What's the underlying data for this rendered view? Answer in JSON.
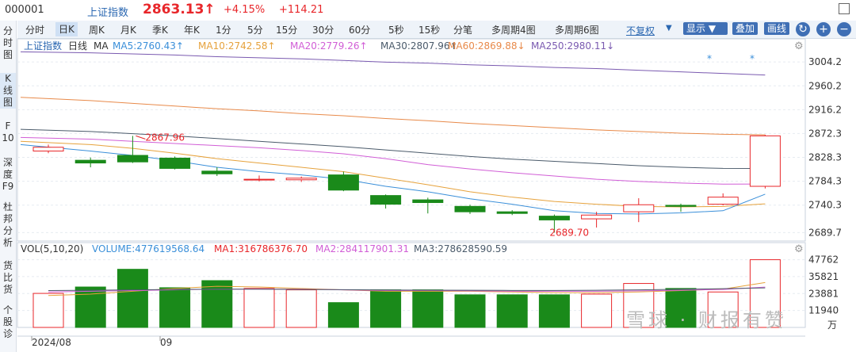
{
  "header": {
    "code": "000001",
    "name": "上证指数",
    "price": "2863.13↑",
    "change_pct": "+4.15%",
    "change_val": "+114.21"
  },
  "toolbar": {
    "tabs": [
      "分时",
      "日K",
      "周K",
      "月K",
      "季K",
      "年K",
      "1分",
      "5分",
      "15分",
      "30分",
      "60分",
      "5秒",
      "15秒",
      "分笔",
      "多周期4图",
      "多周期6图"
    ],
    "active": "日K",
    "fuquan": "不复权",
    "display": "显示",
    "overlay": "叠加",
    "draw": "画线"
  },
  "sidebar": [
    {
      "label": "分\n时\n图"
    },
    {
      "label": "K\n线\n图",
      "active": true
    },
    {
      "label": "F\n10"
    },
    {
      "label": "深\n度\nF9"
    },
    {
      "label": "杜\n邦\n分\n析"
    },
    {
      "label": "货\n比\n货"
    },
    {
      "label": "个\n股\n诊"
    }
  ],
  "ma_legend": {
    "name": "上证指数",
    "period": "日线",
    "label": "MA",
    "ma5": "MA5:2760.43↑",
    "ma10": "MA10:2742.58↑",
    "ma20": "MA20:2779.26↑",
    "ma30": "MA30:2807.96↑",
    "ma60": "MA60:2869.88↓",
    "ma250": "MA250:2980.11↓"
  },
  "vol_legend": {
    "label": "VOL(5,10,20)",
    "volume": "VOLUME:477619568.64",
    "ma1": "MA1:316786376.70",
    "ma2": "MA2:284117901.31",
    "ma3": "MA3:278628590.59"
  },
  "annotations": {
    "high": "2867.96",
    "low": "2689.70"
  },
  "watermark": "雪球 · 财报有赞",
  "colors": {
    "up": "#e8262a",
    "down": "#1a8a1a",
    "ma5": "#3a8fd9",
    "ma10": "#e6a23c",
    "ma20": "#d15ed6",
    "ma30": "#4a5a6a",
    "ma60": "#e88a4a",
    "ma250": "#7a5ab0"
  },
  "chart_data": {
    "type": "candlestick",
    "price_ticks": [
      3004.2,
      2960.2,
      2916.2,
      2872.3,
      2828.3,
      2784.3,
      2740.3,
      2689.7
    ],
    "volume_ticks": [
      47762,
      35821,
      23881,
      11940
    ],
    "volume_unit": "万",
    "x_labels": [
      "2024/08",
      "09"
    ],
    "candles": [
      {
        "o": 2840,
        "c": 2847,
        "h": 2852,
        "l": 2836,
        "v": 24000
      },
      {
        "o": 2823,
        "c": 2818,
        "h": 2828,
        "l": 2810,
        "v": 28500
      },
      {
        "o": 2832,
        "c": 2820,
        "h": 2867.96,
        "l": 2818,
        "v": 41000
      },
      {
        "o": 2827,
        "c": 2808,
        "h": 2830,
        "l": 2806,
        "v": 28000
      },
      {
        "o": 2803,
        "c": 2798,
        "h": 2810,
        "l": 2794,
        "v": 33000
      },
      {
        "o": 2788,
        "c": 2788,
        "h": 2795,
        "l": 2784,
        "v": 27500
      },
      {
        "o": 2787,
        "c": 2790,
        "h": 2793,
        "l": 2783,
        "v": 26500
      },
      {
        "o": 2796,
        "c": 2768,
        "h": 2802,
        "l": 2766,
        "v": 17500
      },
      {
        "o": 2758,
        "c": 2742,
        "h": 2760,
        "l": 2734,
        "v": 26500
      },
      {
        "o": 2750,
        "c": 2745,
        "h": 2754,
        "l": 2725,
        "v": 26500
      },
      {
        "o": 2738,
        "c": 2728,
        "h": 2741,
        "l": 2724,
        "v": 23000
      },
      {
        "o": 2728,
        "c": 2725,
        "h": 2731,
        "l": 2722,
        "v": 23000
      },
      {
        "o": 2720,
        "c": 2713,
        "h": 2723,
        "l": 2689.7,
        "v": 23000
      },
      {
        "o": 2715,
        "c": 2722,
        "h": 2728,
        "l": 2699,
        "v": 23500
      },
      {
        "o": 2728,
        "c": 2741,
        "h": 2753,
        "l": 2709,
        "v": 31000
      },
      {
        "o": 2740,
        "c": 2738,
        "h": 2743,
        "l": 2728,
        "v": 27500
      },
      {
        "o": 2742,
        "c": 2755,
        "h": 2762,
        "l": 2740,
        "v": 25000
      },
      {
        "o": 2775,
        "c": 2868,
        "h": 2870,
        "l": 2771,
        "v": 47762
      }
    ],
    "ma_lines": {
      "ma5": [
        2852,
        2840,
        2832,
        2822,
        2810,
        2802,
        2796,
        2788,
        2775,
        2765,
        2752,
        2742,
        2730,
        2725,
        2724,
        2726,
        2730,
        2760.43
      ],
      "ma10": [
        2858,
        2852,
        2845,
        2836,
        2826,
        2818,
        2810,
        2802,
        2790,
        2778,
        2765,
        2755,
        2747,
        2742,
        2738,
        2737,
        2738,
        2742.58
      ],
      "ma20": [
        2865,
        2862,
        2858,
        2854,
        2850,
        2846,
        2841,
        2835,
        2826,
        2815,
        2807,
        2800,
        2794,
        2788,
        2784,
        2781,
        2779,
        2779.26
      ],
      "ma30": [
        2880,
        2876,
        2872,
        2868,
        2863,
        2858,
        2853,
        2848,
        2842,
        2836,
        2830,
        2825,
        2821,
        2817,
        2813,
        2810,
        2808,
        2807.96
      ],
      "ma60": [
        2939,
        2933,
        2928,
        2923,
        2918,
        2914,
        2909,
        2905,
        2900,
        2896,
        2891,
        2887,
        2883,
        2879,
        2876,
        2873,
        2871,
        2869.88
      ],
      "ma250": [
        3023,
        3021,
        3019,
        3017,
        3014,
        3012,
        3010,
        3007,
        3004,
        3002,
        2999,
        2997,
        2994,
        2992,
        2989,
        2986,
        2983,
        2980.11
      ]
    },
    "vol_ma_lines": {
      "ma1": [
        22500,
        23500,
        25500,
        27500,
        29000,
        28500,
        27500,
        26500,
        25500,
        25500,
        25500,
        25000,
        24500,
        24500,
        25000,
        26000,
        27000,
        31678
      ],
      "ma2": [
        25000,
        25500,
        26000,
        26500,
        27000,
        27000,
        27000,
        26500,
        26000,
        26000,
        25800,
        25500,
        25500,
        25500,
        25800,
        26200,
        26800,
        28412
      ],
      "ma3": [
        26000,
        26200,
        26500,
        26800,
        27000,
        27000,
        26800,
        26600,
        26400,
        26300,
        26200,
        26100,
        26100,
        26200,
        26500,
        26900,
        27300,
        27863
      ]
    }
  }
}
